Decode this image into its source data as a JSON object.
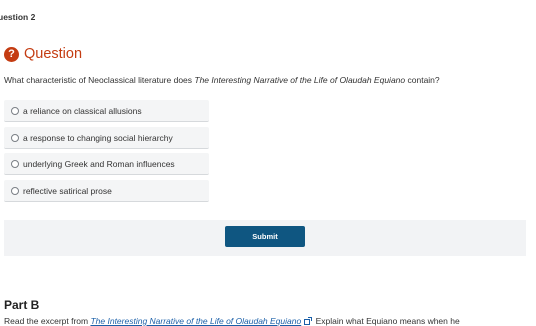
{
  "question_number": "uestion 2",
  "question_header": {
    "icon": "question-mark",
    "title": "Question"
  },
  "prompt": {
    "before": "What characteristic of Neoclassical literature does ",
    "title": "The Interesting Narrative of the Life of Olaudah Equiano",
    "after": " contain?"
  },
  "options": [
    {
      "label": "a reliance on classical allusions",
      "selected": false
    },
    {
      "label": "a response to changing social hierarchy",
      "selected": false
    },
    {
      "label": "underlying Greek and Roman influences",
      "selected": false
    },
    {
      "label": "reflective satirical prose",
      "selected": false
    }
  ],
  "submit_label": "Submit",
  "colors": {
    "accent": "#c43c12",
    "button": "#0f5681",
    "link": "#1a5fa8"
  },
  "part_b": {
    "title": "Part B",
    "text_before": "Read the excerpt from ",
    "link_text": "The Interesting Narrative of the Life of Olaudah Equiano",
    "text_after": " Explain what Equiano means when he"
  }
}
